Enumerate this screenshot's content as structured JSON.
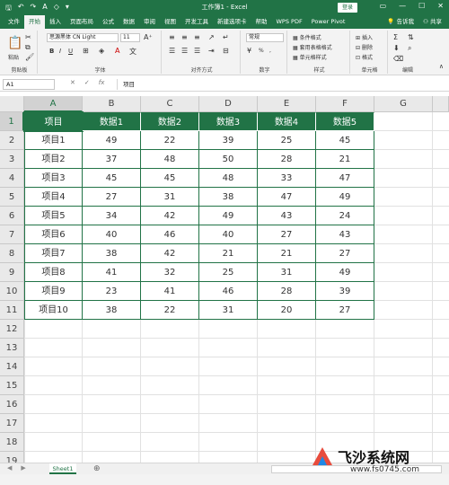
{
  "title_bar": {
    "title": "工作簿1 - Excel",
    "login": "登录"
  },
  "tabs": [
    "文件",
    "开始",
    "插入",
    "页面布局",
    "公式",
    "数据",
    "审阅",
    "视图",
    "开发工具",
    "新建选项卡",
    "帮助",
    "WPS PDF",
    "Power Pivot"
  ],
  "active_tab": "开始",
  "tab_right": {
    "tell_me": "告诉我",
    "share": "共享"
  },
  "ribbon": {
    "clipboard": {
      "paste": "粘贴",
      "group": "剪贴板"
    },
    "font": {
      "name": "思源黑体 CN Light",
      "size": "11",
      "bold": "B",
      "italic": "I",
      "underline": "U",
      "group": "字体"
    },
    "alignment": {
      "group": "对齐方式"
    },
    "number": {
      "format": "常规",
      "percent": "%",
      "comma": ",",
      "group": "数字"
    },
    "styles": {
      "conditional": "条件格式",
      "table_format": "套用表格格式",
      "cell_styles": "单元格样式",
      "group": "样式"
    },
    "cells": {
      "insert": "插入",
      "delete": "删除",
      "format": "格式",
      "group": "单元格"
    },
    "editing": {
      "group": "编辑"
    }
  },
  "formula_bar": {
    "name_box": "A1",
    "fx": "fx",
    "content": "项目"
  },
  "columns": [
    "A",
    "B",
    "C",
    "D",
    "E",
    "F",
    "G"
  ],
  "row_numbers": [
    "1",
    "2",
    "3",
    "4",
    "5",
    "6",
    "7",
    "8",
    "9",
    "10",
    "11",
    "12",
    "13",
    "14",
    "15",
    "16",
    "17",
    "18",
    "19"
  ],
  "table": {
    "headers": [
      "项目",
      "数据1",
      "数据2",
      "数据3",
      "数据4",
      "数据5"
    ],
    "rows": [
      [
        "项目1",
        "49",
        "22",
        "39",
        "25",
        "45"
      ],
      [
        "项目2",
        "37",
        "48",
        "50",
        "28",
        "21"
      ],
      [
        "项目3",
        "45",
        "45",
        "48",
        "33",
        "47"
      ],
      [
        "项目4",
        "27",
        "31",
        "38",
        "47",
        "49"
      ],
      [
        "项目5",
        "34",
        "42",
        "49",
        "43",
        "24"
      ],
      [
        "项目6",
        "40",
        "46",
        "40",
        "27",
        "43"
      ],
      [
        "项目7",
        "38",
        "42",
        "21",
        "21",
        "27"
      ],
      [
        "项目8",
        "41",
        "32",
        "25",
        "31",
        "49"
      ],
      [
        "项目9",
        "23",
        "41",
        "46",
        "28",
        "39"
      ],
      [
        "项目10",
        "38",
        "22",
        "31",
        "20",
        "27"
      ]
    ]
  },
  "sheet_tabs": [
    "Sheet1"
  ],
  "watermark": {
    "name": "飞沙系统网",
    "url": "www.fs0745.com"
  },
  "colors": {
    "accent": "#217346",
    "header_fill": "#217346",
    "header_text": "#ffffff"
  }
}
